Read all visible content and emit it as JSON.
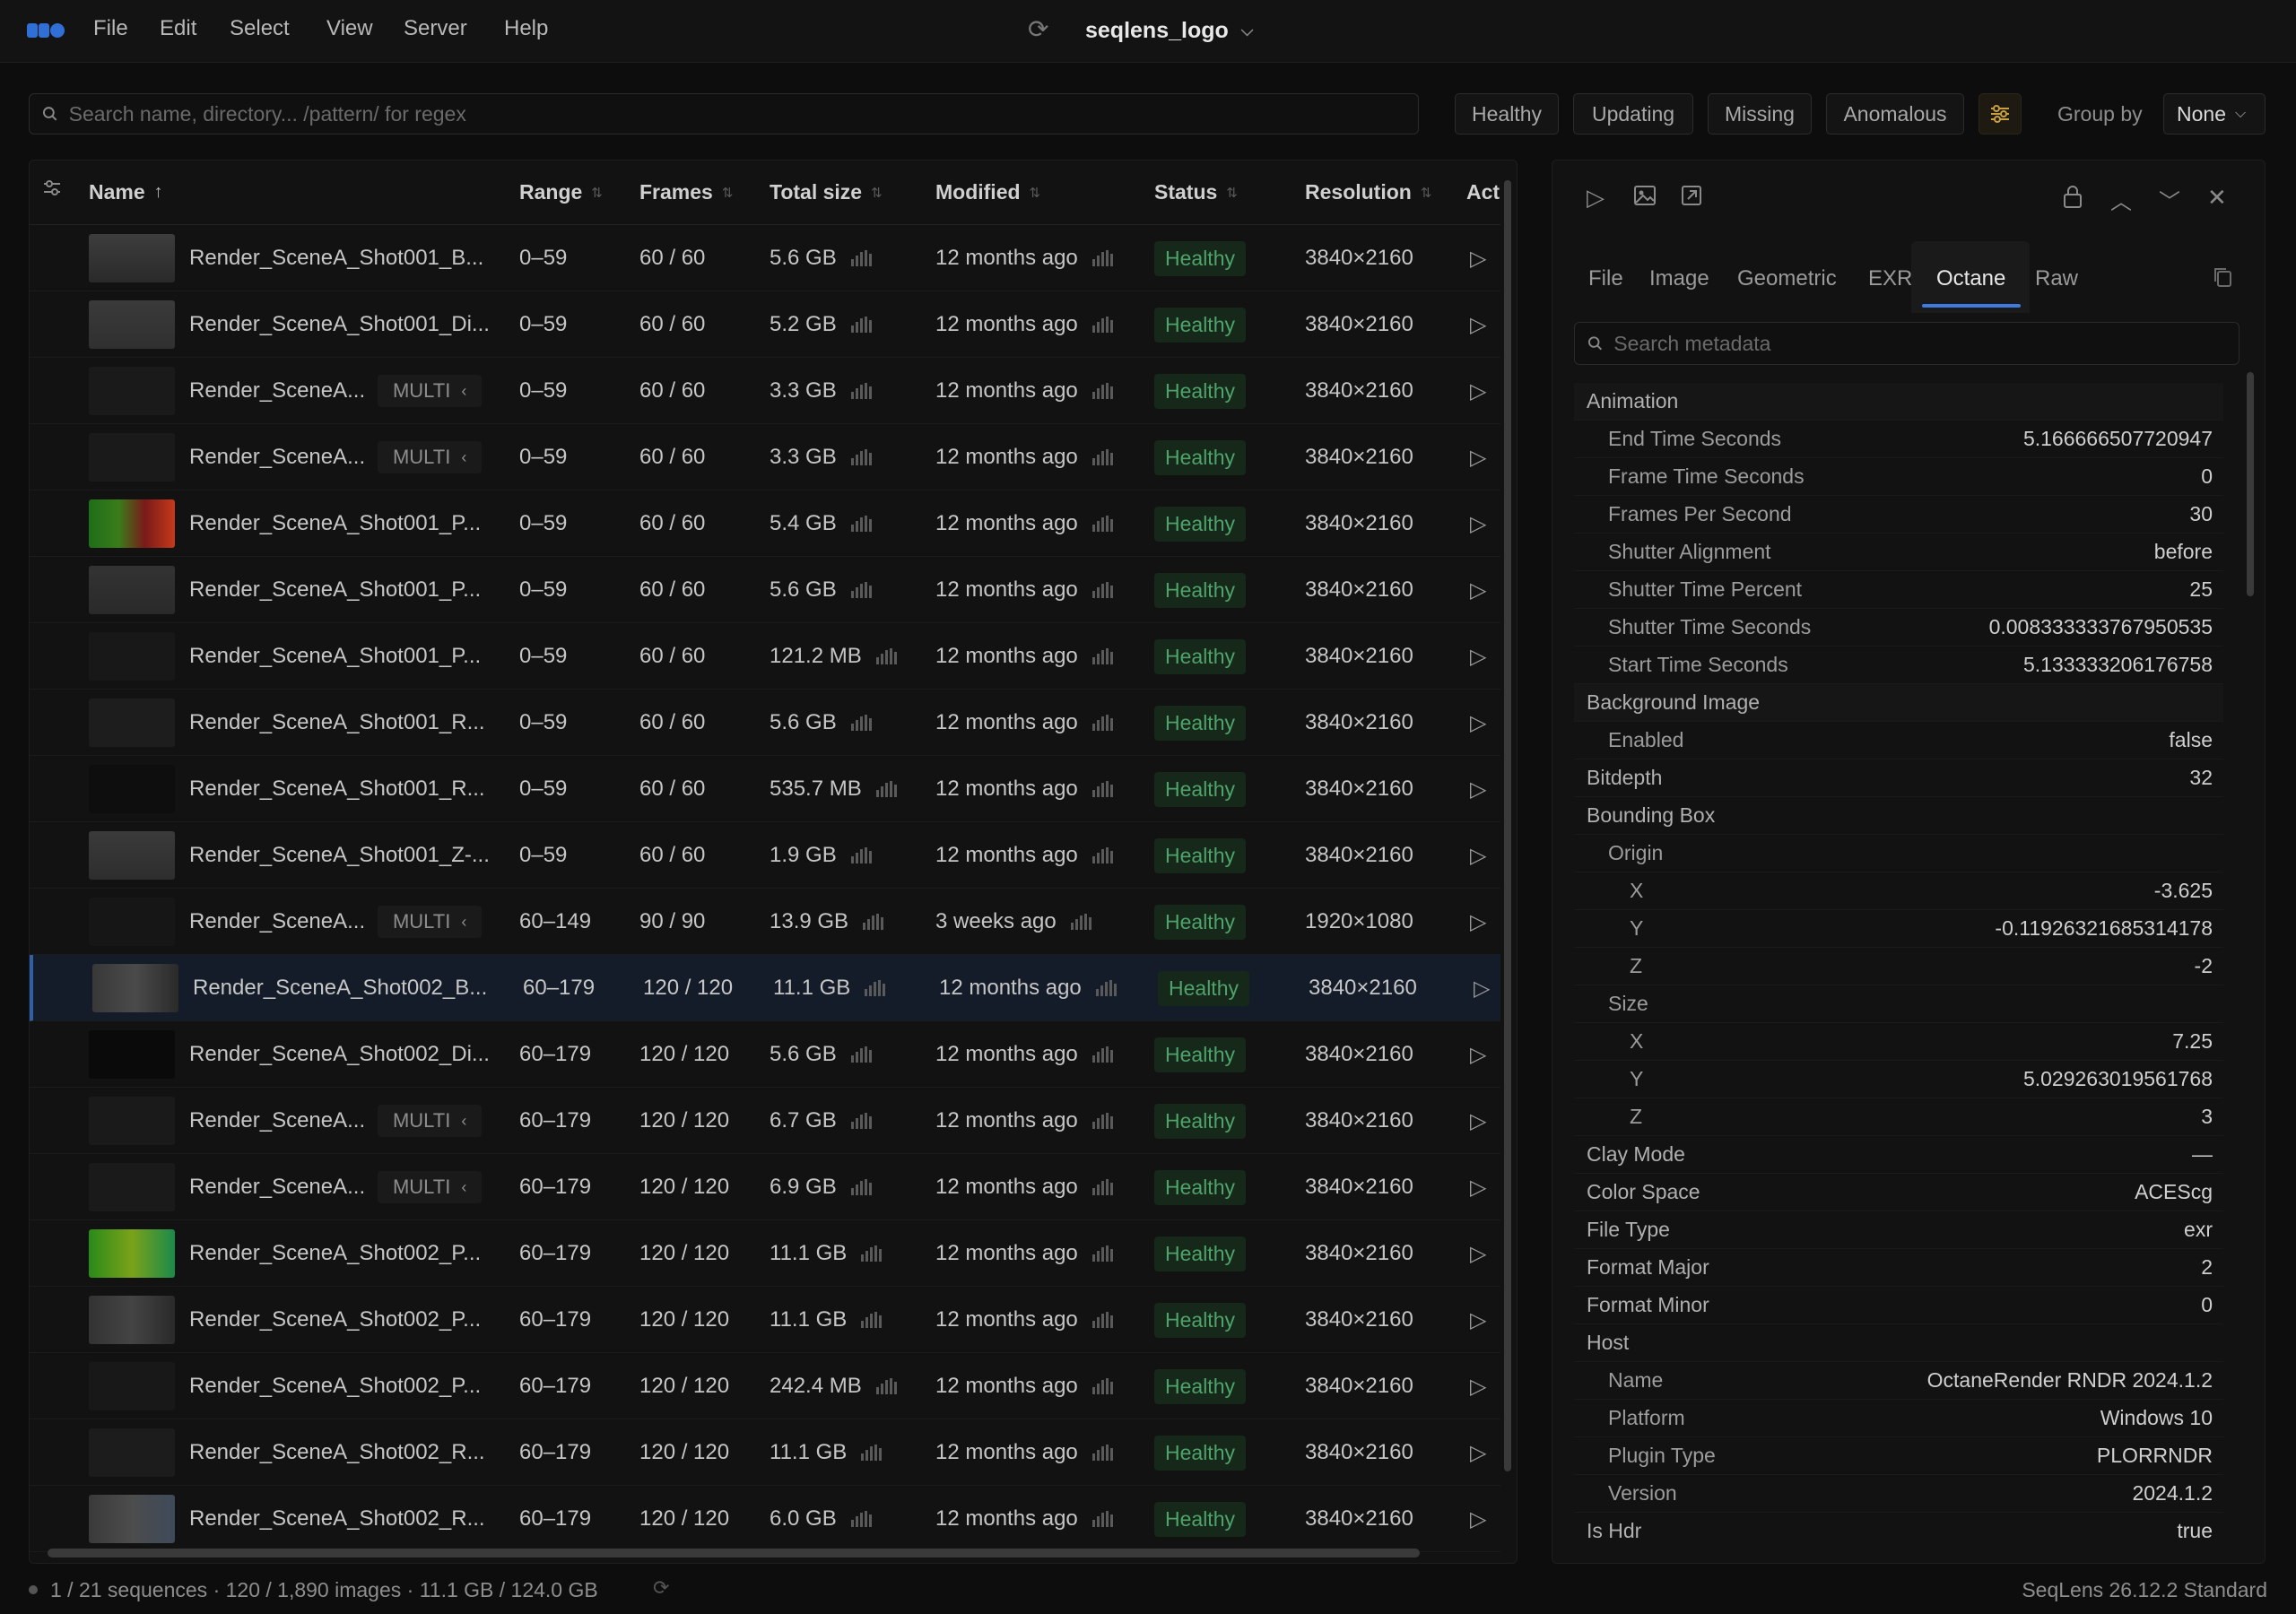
{
  "menubar": {
    "items": [
      "File",
      "Edit",
      "Select",
      "View",
      "Server",
      "Help"
    ],
    "project_name": "seqlens_logo"
  },
  "toolbar": {
    "search_placeholder": "Search name, directory... /pattern/ for regex",
    "filters": [
      "Healthy",
      "Updating",
      "Missing",
      "Anomalous"
    ],
    "group_by_label": "Group by",
    "group_by_value": "None"
  },
  "table": {
    "columns": [
      "Name",
      "Range",
      "Frames",
      "Total size",
      "Modified",
      "Status",
      "Resolution",
      "Act"
    ],
    "rows": [
      {
        "name": "Render_SceneA_Shot001_B...",
        "multi": "",
        "range": "0–59",
        "frames": "60 / 60",
        "size": "5.6 GB",
        "modified": "12 months ago",
        "status": "Healthy",
        "resolution": "3840×2160",
        "selected": false
      },
      {
        "name": "Render_SceneA_Shot001_Di...",
        "multi": "",
        "range": "0–59",
        "frames": "60 / 60",
        "size": "5.2 GB",
        "modified": "12 months ago",
        "status": "Healthy",
        "resolution": "3840×2160",
        "selected": false
      },
      {
        "name": "Render_SceneA...",
        "multi": "MULTI",
        "range": "0–59",
        "frames": "60 / 60",
        "size": "3.3 GB",
        "modified": "12 months ago",
        "status": "Healthy",
        "resolution": "3840×2160",
        "selected": false
      },
      {
        "name": "Render_SceneA...",
        "multi": "MULTI",
        "range": "0–59",
        "frames": "60 / 60",
        "size": "3.3 GB",
        "modified": "12 months ago",
        "status": "Healthy",
        "resolution": "3840×2160",
        "selected": false
      },
      {
        "name": "Render_SceneA_Shot001_P...",
        "multi": "",
        "range": "0–59",
        "frames": "60 / 60",
        "size": "5.4 GB",
        "modified": "12 months ago",
        "status": "Healthy",
        "resolution": "3840×2160",
        "selected": false
      },
      {
        "name": "Render_SceneA_Shot001_P...",
        "multi": "",
        "range": "0–59",
        "frames": "60 / 60",
        "size": "5.6 GB",
        "modified": "12 months ago",
        "status": "Healthy",
        "resolution": "3840×2160",
        "selected": false
      },
      {
        "name": "Render_SceneA_Shot001_P...",
        "multi": "",
        "range": "0–59",
        "frames": "60 / 60",
        "size": "121.2 MB",
        "modified": "12 months ago",
        "status": "Healthy",
        "resolution": "3840×2160",
        "selected": false
      },
      {
        "name": "Render_SceneA_Shot001_R...",
        "multi": "",
        "range": "0–59",
        "frames": "60 / 60",
        "size": "5.6 GB",
        "modified": "12 months ago",
        "status": "Healthy",
        "resolution": "3840×2160",
        "selected": false
      },
      {
        "name": "Render_SceneA_Shot001_R...",
        "multi": "",
        "range": "0–59",
        "frames": "60 / 60",
        "size": "535.7 MB",
        "modified": "12 months ago",
        "status": "Healthy",
        "resolution": "3840×2160",
        "selected": false
      },
      {
        "name": "Render_SceneA_Shot001_Z-...",
        "multi": "",
        "range": "0–59",
        "frames": "60 / 60",
        "size": "1.9 GB",
        "modified": "12 months ago",
        "status": "Healthy",
        "resolution": "3840×2160",
        "selected": false
      },
      {
        "name": "Render_SceneA...",
        "multi": "MULTI",
        "range": "60–149",
        "frames": "90 / 90",
        "size": "13.9 GB",
        "modified": "3 weeks ago",
        "status": "Healthy",
        "resolution": "1920×1080",
        "selected": false
      },
      {
        "name": "Render_SceneA_Shot002_B...",
        "multi": "",
        "range": "60–179",
        "frames": "120 / 120",
        "size": "11.1 GB",
        "modified": "12 months ago",
        "status": "Healthy",
        "resolution": "3840×2160",
        "selected": true
      },
      {
        "name": "Render_SceneA_Shot002_Di...",
        "multi": "",
        "range": "60–179",
        "frames": "120 / 120",
        "size": "5.6 GB",
        "modified": "12 months ago",
        "status": "Healthy",
        "resolution": "3840×2160",
        "selected": false
      },
      {
        "name": "Render_SceneA...",
        "multi": "MULTI",
        "range": "60–179",
        "frames": "120 / 120",
        "size": "6.7 GB",
        "modified": "12 months ago",
        "status": "Healthy",
        "resolution": "3840×2160",
        "selected": false
      },
      {
        "name": "Render_SceneA...",
        "multi": "MULTI",
        "range": "60–179",
        "frames": "120 / 120",
        "size": "6.9 GB",
        "modified": "12 months ago",
        "status": "Healthy",
        "resolution": "3840×2160",
        "selected": false
      },
      {
        "name": "Render_SceneA_Shot002_P...",
        "multi": "",
        "range": "60–179",
        "frames": "120 / 120",
        "size": "11.1 GB",
        "modified": "12 months ago",
        "status": "Healthy",
        "resolution": "3840×2160",
        "selected": false
      },
      {
        "name": "Render_SceneA_Shot002_P...",
        "multi": "",
        "range": "60–179",
        "frames": "120 / 120",
        "size": "11.1 GB",
        "modified": "12 months ago",
        "status": "Healthy",
        "resolution": "3840×2160",
        "selected": false
      },
      {
        "name": "Render_SceneA_Shot002_P...",
        "multi": "",
        "range": "60–179",
        "frames": "120 / 120",
        "size": "242.4 MB",
        "modified": "12 months ago",
        "status": "Healthy",
        "resolution": "3840×2160",
        "selected": false
      },
      {
        "name": "Render_SceneA_Shot002_R...",
        "multi": "",
        "range": "60–179",
        "frames": "120 / 120",
        "size": "11.1 GB",
        "modified": "12 months ago",
        "status": "Healthy",
        "resolution": "3840×2160",
        "selected": false
      },
      {
        "name": "Render_SceneA_Shot002_R...",
        "multi": "",
        "range": "60–179",
        "frames": "120 / 120",
        "size": "6.0 GB",
        "modified": "12 months ago",
        "status": "Healthy",
        "resolution": "3840×2160",
        "selected": false
      }
    ]
  },
  "metadata": {
    "tabs": [
      "File",
      "Image",
      "Geometric",
      "EXR",
      "Octane",
      "Raw"
    ],
    "active_tab": "Octane",
    "search_placeholder": "Search metadata",
    "entries": [
      {
        "key": "Animation",
        "value": "",
        "depth": 0,
        "group": true
      },
      {
        "key": "End Time Seconds",
        "value": "5.166666507720947",
        "depth": 1,
        "group": false
      },
      {
        "key": "Frame Time Seconds",
        "value": "0",
        "depth": 1,
        "group": false
      },
      {
        "key": "Frames Per Second",
        "value": "30",
        "depth": 1,
        "group": false
      },
      {
        "key": "Shutter Alignment",
        "value": "before",
        "depth": 1,
        "group": false
      },
      {
        "key": "Shutter Time Percent",
        "value": "25",
        "depth": 1,
        "group": false
      },
      {
        "key": "Shutter Time Seconds",
        "value": "0.008333333767950535",
        "depth": 1,
        "group": false
      },
      {
        "key": "Start Time Seconds",
        "value": "5.133333206176758",
        "depth": 1,
        "group": false
      },
      {
        "key": "Background Image",
        "value": "",
        "depth": 0,
        "group": true
      },
      {
        "key": "Enabled",
        "value": "false",
        "depth": 1,
        "group": false
      },
      {
        "key": "Bitdepth",
        "value": "32",
        "depth": 0,
        "group": false
      },
      {
        "key": "Bounding Box",
        "value": "",
        "depth": 0,
        "group": false
      },
      {
        "key": "Origin",
        "value": "",
        "depth": 1,
        "group": false
      },
      {
        "key": "X",
        "value": "-3.625",
        "depth": 2,
        "group": false
      },
      {
        "key": "Y",
        "value": "-0.11926321685314178",
        "depth": 2,
        "group": false
      },
      {
        "key": "Z",
        "value": "-2",
        "depth": 2,
        "group": false
      },
      {
        "key": "Size",
        "value": "",
        "depth": 1,
        "group": false
      },
      {
        "key": "X",
        "value": "7.25",
        "depth": 2,
        "group": false
      },
      {
        "key": "Y",
        "value": "5.029263019561768",
        "depth": 2,
        "group": false
      },
      {
        "key": "Z",
        "value": "3",
        "depth": 2,
        "group": false
      },
      {
        "key": "Clay Mode",
        "value": "—",
        "depth": 0,
        "group": false
      },
      {
        "key": "Color Space",
        "value": "ACEScg",
        "depth": 0,
        "group": false
      },
      {
        "key": "File Type",
        "value": "exr",
        "depth": 0,
        "group": false
      },
      {
        "key": "Format Major",
        "value": "2",
        "depth": 0,
        "group": false
      },
      {
        "key": "Format Minor",
        "value": "0",
        "depth": 0,
        "group": false
      },
      {
        "key": "Host",
        "value": "",
        "depth": 0,
        "group": false
      },
      {
        "key": "Name",
        "value": "OctaneRender RNDR 2024.1.2",
        "depth": 1,
        "group": false
      },
      {
        "key": "Platform",
        "value": "Windows 10",
        "depth": 1,
        "group": false
      },
      {
        "key": "Plugin Type",
        "value": "PLORRNDR",
        "depth": 1,
        "group": false
      },
      {
        "key": "Version",
        "value": "2024.1.2",
        "depth": 1,
        "group": false
      },
      {
        "key": "Is Hdr",
        "value": "true",
        "depth": 0,
        "group": false
      }
    ]
  },
  "statusbar": {
    "summary": "1 / 21 sequences · 120 / 1,890 images · 11.1 GB / 124.0 GB",
    "version": "SeqLens 26.12.2 Standard"
  },
  "colors": {
    "accent": "#3e7ae0",
    "healthy_text": "#4fa36a",
    "healthy_bg": "#15281a",
    "selected_row": "#151c29",
    "filter_icon": "#c8a040"
  },
  "icons": {
    "sync": "sync-icon",
    "search": "search-icon",
    "filter_settings": "sliders-icon",
    "play": "play-icon",
    "image": "image-icon",
    "pop_out": "external-link-icon",
    "lock": "lock-icon",
    "copy": "copy-icon"
  }
}
